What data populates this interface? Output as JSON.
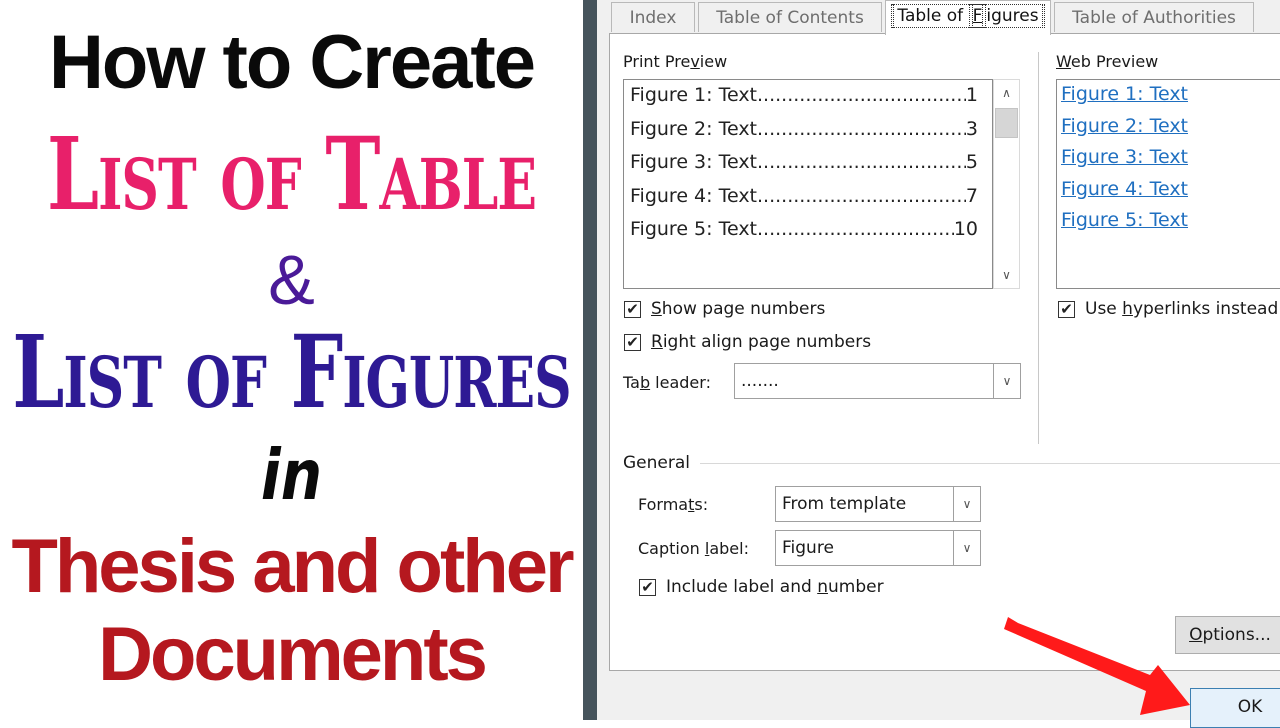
{
  "thumbnail": {
    "line1": "How to Create",
    "line2": "List of Table",
    "line3": "&",
    "line4": "List of Figures",
    "line5": "in",
    "line6": "Thesis and other",
    "line7": "Documents",
    "colors": {
      "line1": "#0a0a0a",
      "line2": "#e8206a",
      "line3": "#4a1a98",
      "line4": "#2e1a94",
      "line5": "#0a0a0a",
      "line6": "#b5181f"
    }
  },
  "dialog": {
    "tabs": [
      {
        "label": "Index",
        "active": false
      },
      {
        "label": "Table of Contents",
        "active": false
      },
      {
        "label_pre": "Table of ",
        "label_u": "F",
        "label_post": "igures",
        "label": "Table of Figures",
        "active": true
      },
      {
        "label": "Table of Authorities",
        "active": false
      }
    ],
    "print_preview": {
      "label_pre": "Print Pre",
      "label_u": "v",
      "label_post": "iew",
      "entries": [
        {
          "text": "Figure 1: Text",
          "page": "1"
        },
        {
          "text": "Figure 2: Text",
          "page": "3"
        },
        {
          "text": "Figure 3: Text",
          "page": "5"
        },
        {
          "text": "Figure 4: Text",
          "page": "7"
        },
        {
          "text": "Figure 5: Text",
          "page": "10"
        }
      ],
      "dots": "................................................................"
    },
    "web_preview": {
      "label_u": "W",
      "label_post": "eb Preview",
      "links": [
        "Figure 1: Text",
        "Figure 2: Text",
        "Figure 3: Text",
        "Figure 4: Text",
        "Figure 5: Text"
      ],
      "link_color": "#1f6fc0"
    },
    "show_page_numbers": {
      "label_u": "S",
      "label_post": "how page numbers",
      "checked": true
    },
    "right_align": {
      "label_u": "R",
      "label_post": "ight align page numbers",
      "checked": true
    },
    "use_hyperlinks": {
      "label_pre": "Use ",
      "label_u": "h",
      "label_post": "yperlinks instead",
      "checked": true
    },
    "tab_leader": {
      "label_pre": "Ta",
      "label_u": "b",
      "label_post": " leader:",
      "value": "......."
    },
    "general": {
      "title": "General",
      "formats": {
        "label_pre": "Forma",
        "label_u": "t",
        "label_post": "s:",
        "value": "From template"
      },
      "caption_label": {
        "label_pre": "Caption ",
        "label_u": "l",
        "label_post": "abel:",
        "value": "Figure"
      },
      "include_label": {
        "label_pre": "Include label and ",
        "label_u": "n",
        "label_post": "umber",
        "checked": true
      }
    },
    "options_button": {
      "label_u": "O",
      "label_post": "ptions..."
    },
    "ok_button": {
      "label": "OK"
    },
    "checkmark": "✔",
    "arrow_down": "⌄",
    "arrow_up": "⌃",
    "annotation_arrow_color": "#ff1a1a"
  }
}
